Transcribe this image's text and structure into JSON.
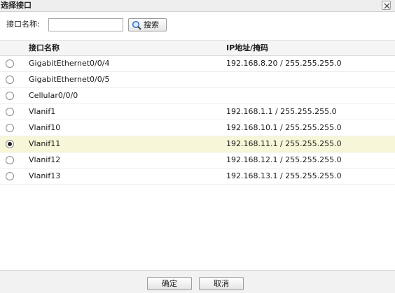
{
  "dialog": {
    "title": "选择接口",
    "close_icon": "close-icon"
  },
  "search": {
    "label": "接口名称:",
    "value": "",
    "placeholder": "",
    "button_label": "搜索",
    "button_icon": "magnifier-icon"
  },
  "table": {
    "columns": [
      "接口名称",
      "IP地址/掩码"
    ],
    "rows": [
      {
        "name": "GigabitEthernet0/0/4",
        "ip": "192.168.8.20 / 255.255.255.0",
        "selected": false
      },
      {
        "name": "GigabitEthernet0/0/5",
        "ip": "",
        "selected": false
      },
      {
        "name": "Cellular0/0/0",
        "ip": "",
        "selected": false
      },
      {
        "name": "Vlanif1",
        "ip": "192.168.1.1 / 255.255.255.0",
        "selected": false
      },
      {
        "name": "Vlanif10",
        "ip": "192.168.10.1 / 255.255.255.0",
        "selected": false
      },
      {
        "name": "Vlanif11",
        "ip": "192.168.11.1 / 255.255.255.0",
        "selected": true
      },
      {
        "name": "Vlanif12",
        "ip": "192.168.12.1 / 255.255.255.0",
        "selected": false
      },
      {
        "name": "Vlanif13",
        "ip": "192.168.13.1 / 255.255.255.0",
        "selected": false
      }
    ]
  },
  "footer": {
    "ok_label": "确定",
    "cancel_label": "取消"
  },
  "colors": {
    "selected_row": "#f7f6d8",
    "header_bg": "#f5f5f5",
    "footer_bg": "#f2f2f2"
  }
}
